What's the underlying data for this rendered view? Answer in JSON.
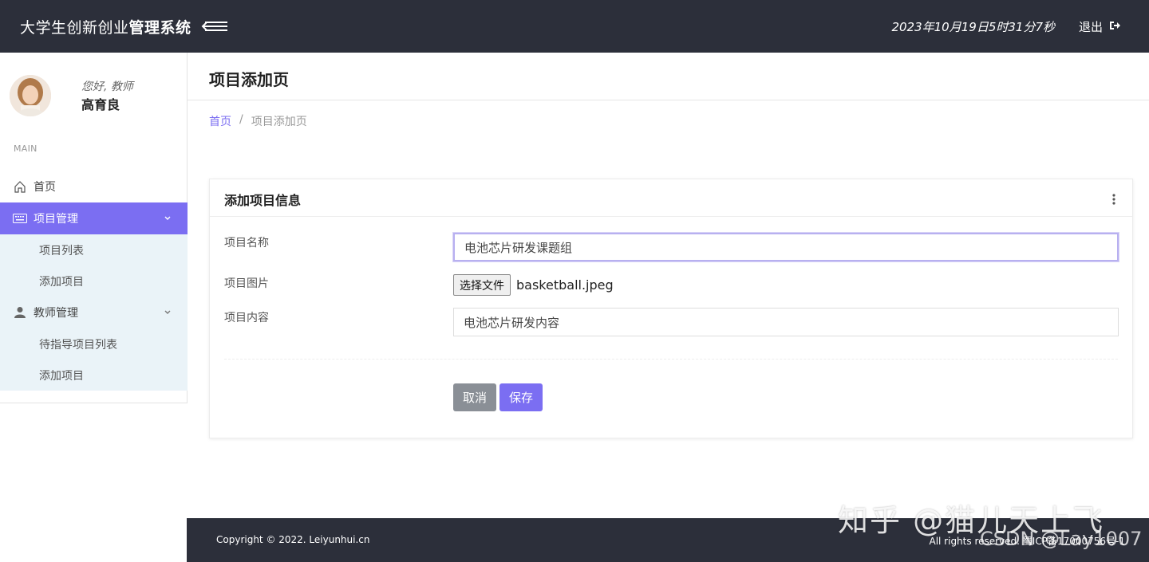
{
  "header": {
    "brand_prefix": "大学生创新创业",
    "brand_strong": "管理系统",
    "datetime": "2023年10月19日5时31分7秒",
    "logout_label": "退出"
  },
  "profile": {
    "greeting": "您好, 教师",
    "name": "高育良"
  },
  "sidebar": {
    "section_label": "MAIN",
    "items": [
      {
        "label": "首页",
        "icon": "home-icon"
      },
      {
        "label": "项目管理",
        "icon": "keyboard-icon",
        "active": true,
        "children": [
          {
            "label": "项目列表"
          },
          {
            "label": "添加项目"
          }
        ]
      },
      {
        "label": "教师管理",
        "icon": "user-icon",
        "children": [
          {
            "label": "待指导项目列表"
          },
          {
            "label": "添加项目"
          }
        ]
      }
    ]
  },
  "page": {
    "title": "项目添加页",
    "breadcrumb": {
      "home": "首页",
      "sep": "/",
      "current": "项目添加页"
    }
  },
  "form": {
    "card_title": "添加项目信息",
    "name_label": "项目名称",
    "name_value": "电池芯片研发课题组",
    "image_label": "项目图片",
    "file_button_label": "选择文件",
    "file_name": "basketball.jpeg",
    "content_label": "项目内容",
    "content_value": "电池芯片研发内容",
    "cancel_label": "取消",
    "save_label": "保存"
  },
  "footer": {
    "copyright": "Copyright © 2022. Leiyunhui.cn",
    "rights": "All rights reserved. 蜀ICP备17000756号-1"
  },
  "watermarks": {
    "zhihu": "知乎 @猫儿天上飞",
    "csdn": "CSDN @Lay1007"
  },
  "colors": {
    "accent": "#7b6ef2",
    "header_bg": "#2c2f3a",
    "submenu_bg": "#eaf3f8"
  }
}
